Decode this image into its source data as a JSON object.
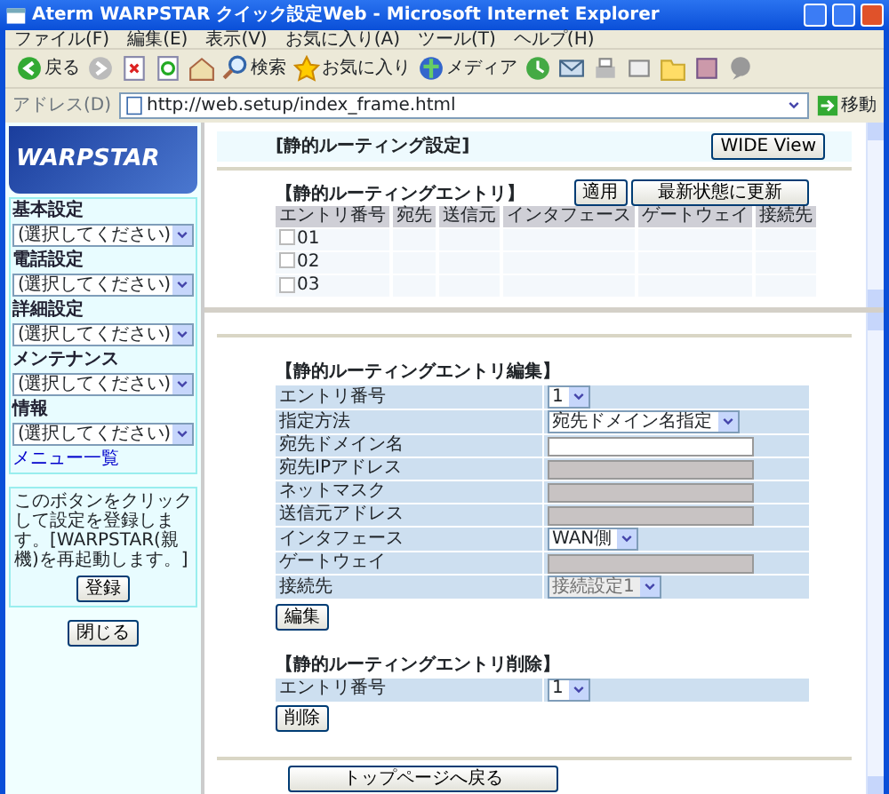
{
  "window": {
    "title": "Aterm WARPSTAR クイック設定Web - Microsoft Internet Explorer"
  },
  "menu_bar": [
    "ファイル(F)",
    "編集(E)",
    "表示(V)",
    "お気に入り(A)",
    "ツール(T)",
    "ヘルプ(H)"
  ],
  "toolbar": [
    {
      "kind": "back",
      "label": "戻る"
    },
    {
      "kind": "forward"
    },
    {
      "kind": "stop"
    },
    {
      "kind": "refresh"
    },
    {
      "kind": "home"
    },
    {
      "kind": "search",
      "label": "検索"
    },
    {
      "kind": "favorites",
      "label": "お気に入り"
    },
    {
      "kind": "media",
      "label": "メディア"
    },
    {
      "kind": "history"
    },
    {
      "kind": "mail"
    },
    {
      "kind": "print"
    },
    {
      "kind": "edit"
    },
    {
      "kind": "folder"
    },
    {
      "kind": "research"
    },
    {
      "kind": "messenger"
    }
  ],
  "address": {
    "label": "アドレス(D)",
    "value": "http://web.setup/index_frame.html",
    "go": "移動"
  },
  "sidebar": {
    "logo": "WARPSTAR",
    "groups": [
      {
        "label": "基本設定",
        "select": "(選択してください)"
      },
      {
        "label": "電話設定",
        "select": "(選択してください)"
      },
      {
        "label": "詳細設定",
        "select": "(選択してください)"
      },
      {
        "label": "メンテナンス",
        "select": "(選択してください)"
      },
      {
        "label": "情報",
        "select": "(選択してください)"
      }
    ],
    "menu_link": "メニュー一覧",
    "note": "このボタンをクリックして設定を登録します。[WARPSTAR(親機)を再起動します。]",
    "register_button": "登録",
    "close_button": "閉じる"
  },
  "top_frame": {
    "title": "[静的ルーティング設定]",
    "wide_button": "WIDE View",
    "section_title": "【静的ルーティングエントリ】",
    "apply_button": "適用",
    "refresh_button": "最新状態に更新",
    "columns": [
      "エントリ番号",
      "宛先",
      "送信元",
      "インタフェース",
      "ゲートウェイ",
      "接続先"
    ],
    "rows": [
      {
        "number": "01",
        "checked": false
      },
      {
        "number": "02",
        "checked": false
      },
      {
        "number": "03",
        "checked": false
      }
    ]
  },
  "edit": {
    "title": "【静的ルーティングエントリ編集】",
    "fields": [
      {
        "label": "エントリ番号",
        "kind": "select",
        "value": "1",
        "disabled": false
      },
      {
        "label": "指定方法",
        "kind": "select",
        "value": "宛先ドメイン名指定",
        "disabled": false
      },
      {
        "label": "宛先ドメイン名",
        "kind": "text",
        "disabled": false
      },
      {
        "label": "宛先IPアドレス",
        "kind": "text",
        "disabled": true
      },
      {
        "label": "ネットマスク",
        "kind": "text",
        "disabled": true
      },
      {
        "label": "送信元アドレス",
        "kind": "text",
        "disabled": true
      },
      {
        "label": "インタフェース",
        "kind": "select",
        "value": "WAN側",
        "disabled": false
      },
      {
        "label": "ゲートウェイ",
        "kind": "text",
        "disabled": true
      },
      {
        "label": "接続先",
        "kind": "select",
        "value": "接続設定1",
        "disabled": true
      }
    ],
    "button": "編集"
  },
  "delete": {
    "title": "【静的ルーティングエントリ削除】",
    "fields": [
      {
        "label": "エントリ番号",
        "kind": "select",
        "value": "1",
        "disabled": false
      }
    ],
    "button": "削除"
  },
  "back_button": "トップページへ戻る"
}
